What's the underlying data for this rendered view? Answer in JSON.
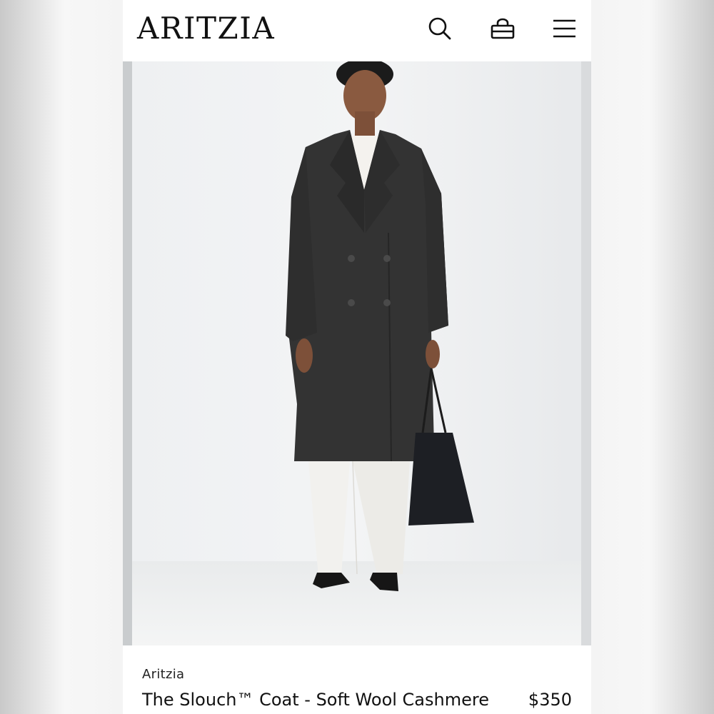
{
  "header": {
    "logo": "ARITZIA",
    "icons": [
      "search-icon",
      "shopping-bag-icon",
      "menu-icon"
    ]
  },
  "hero": {
    "image": "model wearing charcoal double-breasted long coat with white trousers, black flats and black tote bag"
  },
  "product": {
    "brand": "Aritzia",
    "name": "The Slouch™ Coat - Soft Wool Cashmere",
    "price": "$350"
  },
  "colors": {
    "coat": "#333333",
    "background": "#f6f6f6",
    "text": "#111111"
  }
}
